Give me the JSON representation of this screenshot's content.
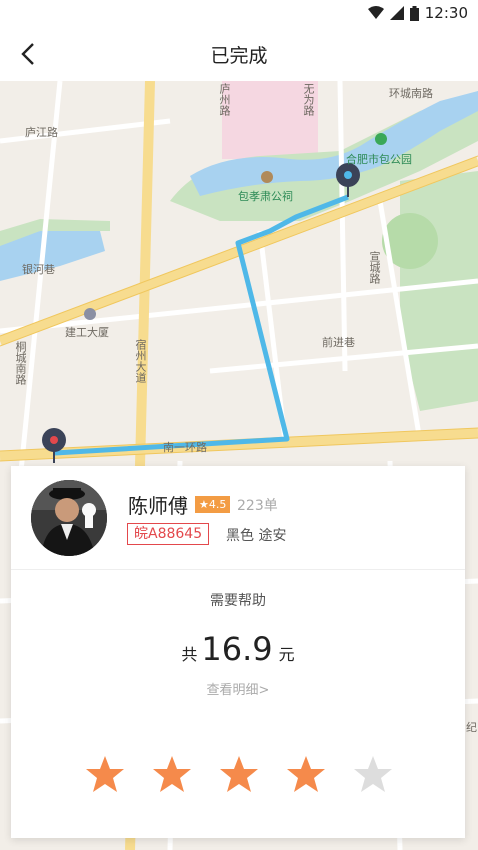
{
  "status_bar": {
    "time": "12:30",
    "icons": [
      "wifi-icon",
      "signal-icon",
      "battery-icon"
    ]
  },
  "nav": {
    "title": "已完成",
    "back_icon": "chevron-left-icon"
  },
  "map": {
    "labels": {
      "lujiang_road": "庐江路",
      "baohe_park": "合肥市包公园",
      "baogong_temple": "包孝肃公祠",
      "huancheng_south": "环城南路",
      "wuwei_road": "无为路",
      "yinhe_lane": "银河巷",
      "jiangong_building": "建工大厦",
      "xuancheng_road": "宣城路",
      "qianjin_lane": "前进巷",
      "tongcheng_south": "桐城南路",
      "south_first_ring": "南一环路",
      "suzhou_road": "宿州大道",
      "luzhou_label": "庐州路",
      "right_label": "纪"
    },
    "route_color": "#4fb8e8",
    "marker_color": "#3b4358"
  },
  "driver": {
    "name": "陈师傅",
    "rating": "★4.5",
    "orders": "223单",
    "plate": "皖A88645",
    "car": "黑色 途安"
  },
  "help_text": "需要帮助",
  "fare": {
    "prefix": "共",
    "amount": "16.9",
    "unit": "元"
  },
  "details_link": "查看明细>",
  "rating_stars": {
    "filled": 4,
    "total": 5,
    "filled_color": "#f58a4b",
    "empty_color": "#dddddd"
  }
}
